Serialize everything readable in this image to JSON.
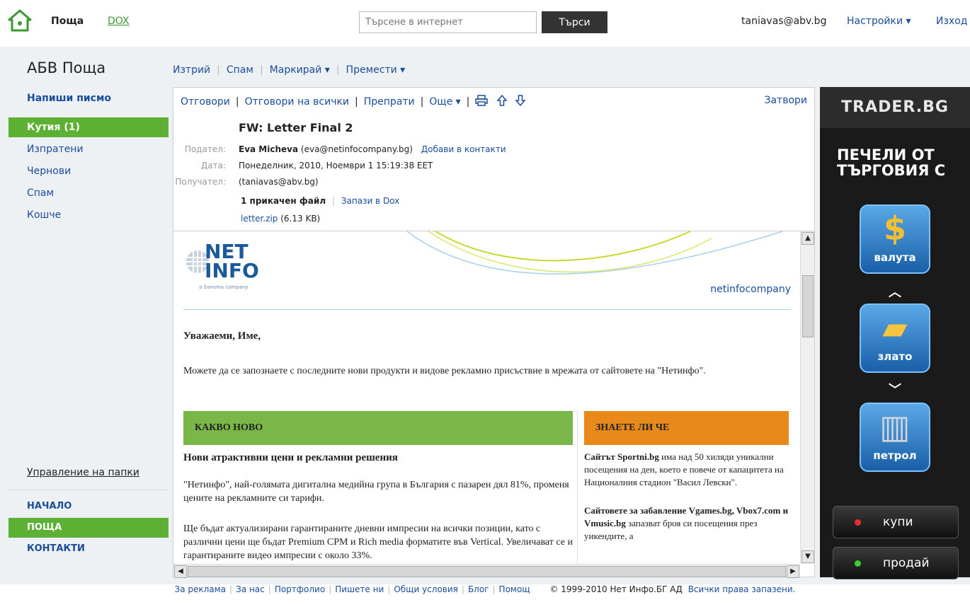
{
  "top": {
    "app_name": "Поща",
    "dox_label": "DOX",
    "search_placeholder": "Търсене в интернет",
    "search_button": "Търси",
    "user_email": "taniavas@abv.bg",
    "settings_label": "Настройки ▾",
    "exit_label": "Изход"
  },
  "sidebar": {
    "brand": "АБВ Поща",
    "compose": "Напиши писмо",
    "folders": [
      "Кутия (1)",
      "Изпратени",
      "Чернови",
      "Спам",
      "Кошче"
    ],
    "manage_folders": "Управление на папки",
    "nav": [
      "НАЧАЛО",
      "ПОЩА",
      "КОНТАКТИ"
    ]
  },
  "toolbar": {
    "delete": "Изтрий",
    "spam": "Спам",
    "mark": "Маркирай ▾",
    "move": "Премести ▾"
  },
  "message": {
    "actions": {
      "reply": "Отговори",
      "reply_all": "Отговори на всички",
      "forward": "Препрати",
      "more": "Още ▾",
      "close": "Затвори"
    },
    "subject": "FW: Letter Final 2",
    "from_label": "Подател:",
    "from_name": "Eva Micheva",
    "from_email": "(eva@netinfocompany.bg)",
    "add_contact": "Добави в контакти",
    "date_label": "Дата:",
    "date_value": "Понеделник, 2010, Ноември 1 15:19:38 EET",
    "to_label": "Получател:",
    "to_value": "(taniavas@abv.bg)",
    "attach_count": "1 прикачен файл",
    "save_dox": "Запази в Dox",
    "attach_name": "letter.zip",
    "attach_size": "(6.13 KB)"
  },
  "email": {
    "logo_text": "NET",
    "logo_text2": "INFO",
    "logo_sub": "a Sanoma company",
    "domain": "netinfocompany",
    "greeting": "Уважаеми, Име,",
    "intro": "Можете да се запознаете с последните нови продукти и видове рекламно присъствие в мрежата от сайтовете на \"Нетинфо\".",
    "left_head": "КАКВО НОВО",
    "news_title": "Нови атрактивни цени и рекламни решения",
    "news_p1": "\"Нетинфо\", най-голямата дигитална медийна група в България с пазарен дял 81%, променя цените на рекламните си тарифи.",
    "news_p2": "Ще бъдат актуализирани гарантираните дневни импресии на всички позиции, като с различни цени ще бъдат Premium CPM и Rich media форматите във Vertical. Увеличават се и гарантираните видео импресии с около 33%.",
    "right_head": "ЗНАЕТЕ ЛИ ЧЕ",
    "fact1_bold": "Сайтът Sportni.bg",
    "fact1_rest": " има над 50 хиляди уникални посещения на ден, което е повече от капацитета на Националния стадион \"Васил Левски\".",
    "fact2_bold": "Сайтовете за забавление Vgames.bg, Vbox7.com и Vmusic.bg",
    "fact2_rest": " запазват броя си посещения през уикендите, а"
  },
  "ad": {
    "brand": "TRADER.BG",
    "tagline_1": "ПЕЧЕЛИ ОТ",
    "tagline_2": "ТЪРГОВИЯ С",
    "tile1": "валута",
    "tile2": "злато",
    "tile3": "петрол",
    "buy": "купи",
    "sell": "продай"
  },
  "footer": {
    "links": [
      "За реклама",
      "За нас",
      "Портфолио",
      "Пишете ни",
      "Общи условия",
      "Блог",
      "Помощ"
    ],
    "copyright": "© 1999-2010 Нет Инфо.БГ АД",
    "rights": "Всички права запазени."
  },
  "colors": {
    "accent_green": "#5cb033",
    "link_blue": "#1a4c9c",
    "orange": "#e8891b"
  }
}
